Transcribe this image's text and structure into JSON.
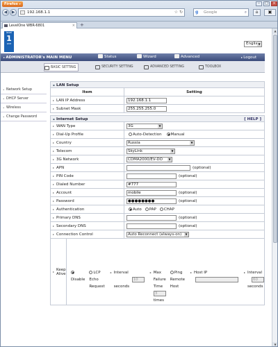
{
  "browser": {
    "app_label": "Firefox",
    "url": "192.168.1.1",
    "search_placeholder": "Google",
    "tab_title": "LevelOne WBR-6801",
    "new_tab": "+"
  },
  "router": {
    "logo_top": "level",
    "logo_big": "1",
    "logo_bottom": "one",
    "language": "English",
    "admin_menu": "ADMINISTRATOR's MAIN MENU",
    "top_links": [
      "Status",
      "Wizard",
      "Advanced",
      "Logout"
    ],
    "main_tabs": [
      "BASIC SETTING",
      "SECURITY SETTING",
      "ADVANCED SETTING",
      "TOOLBOX"
    ],
    "sidebar": [
      "Network Setup",
      "DHCP Server",
      "Wireless",
      "Change Password"
    ]
  },
  "lan": {
    "title": "LAN Setup",
    "col_item": "Item",
    "col_setting": "Setting",
    "ip_label": "LAN IP Address",
    "ip_value": "192.168.1.1",
    "mask_label": "Subnet Mask",
    "mask_value": "255.255.255.0"
  },
  "internet": {
    "title": "Internet Setup",
    "help": "[ HELP ]",
    "wan_label": "WAN Type",
    "wan_value": "3G",
    "dial_label": "Dial-Up Profile",
    "dial_auto": "Auto-Detection",
    "dial_manual": "Manual",
    "country_label": "Country",
    "country_value": "Russia",
    "telecom_label": "Telecom",
    "telecom_value": "SkyLink",
    "net3g_label": "3G Network",
    "net3g_value": "CDMA2000/EV-DO",
    "apn_label": "APN",
    "optional": "(optional)",
    "pin_label": "PIN Code",
    "dialed_label": "Dialed Number",
    "dialed_value": "#777",
    "account_label": "Account",
    "account_value": "mobile",
    "password_label": "Password",
    "password_value": "●●●●●●●●",
    "auth_label": "Authentication",
    "auth_auto": "Auto",
    "auth_pap": "PAP",
    "auth_chap": "CHAP",
    "dns1_label": "Primary DNS",
    "dns2_label": "Secondary DNS",
    "conn_label": "Connection Control",
    "conn_value": "Auto Reconnect (always-on)",
    "keepalive_label": "Keep Alive",
    "ka_disable": "Disable",
    "ka_lcp": "LCP Echo Request",
    "ka_interval": "Interval",
    "ka_interval_value": "10",
    "ka_seconds": "seconds",
    "ka_maxfail": "Max Failure Time",
    "ka_maxfail_value": "3",
    "ka_times": "times",
    "ka_ping": "Ping Remote Host",
    "ka_hostip": "Host IP",
    "ka_interval2_value": "60"
  }
}
